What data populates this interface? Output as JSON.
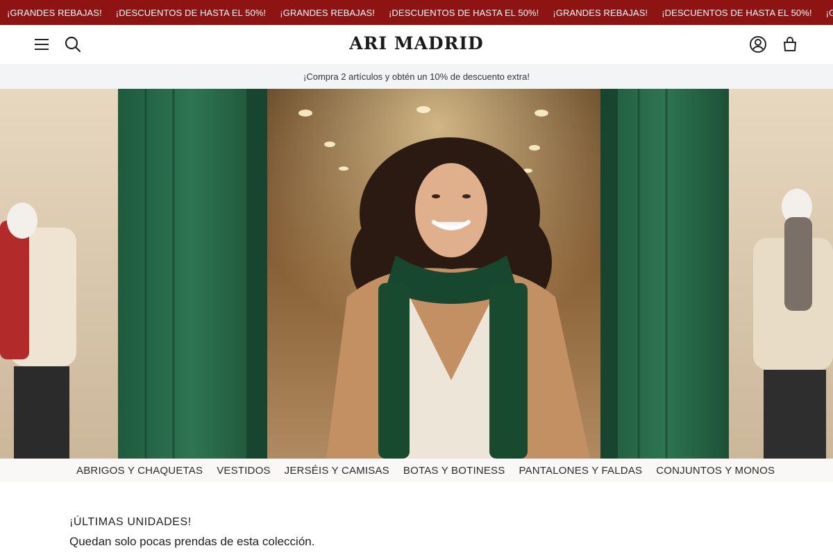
{
  "marquee": {
    "items": [
      "¡GRANDES REBAJAS!",
      "¡DESCUENTOS DE HASTA EL 50%!",
      "¡GRANDES REBAJAS!",
      "¡DESCUENTOS DE HASTA EL 50%!",
      "¡GRANDES REBAJAS!",
      "¡DESCUENTOS DE HASTA EL 50%!",
      "¡GRANDES REBAJAS!"
    ],
    "bg_color": "#8e1414"
  },
  "header": {
    "logo": "ARI MADRID",
    "icons": [
      "menu-icon",
      "search-icon",
      "account-icon",
      "cart-icon"
    ]
  },
  "promo": {
    "text": "¡Compra 2 artículos y obtén un 10% de descuento extra!"
  },
  "categories": [
    "ABRIGOS Y CHAQUETAS",
    "VESTIDOS",
    "JERSÉIS Y CAMISAS",
    "BOTAS Y BOTINESS",
    "PANTALONES Y FALDAS",
    "CONJUNTOS Y MONOS"
  ],
  "section": {
    "title": "¡ÚLTIMAS UNIDADES!",
    "subtitle": "Quedan solo pocas prendas de esta colección."
  }
}
